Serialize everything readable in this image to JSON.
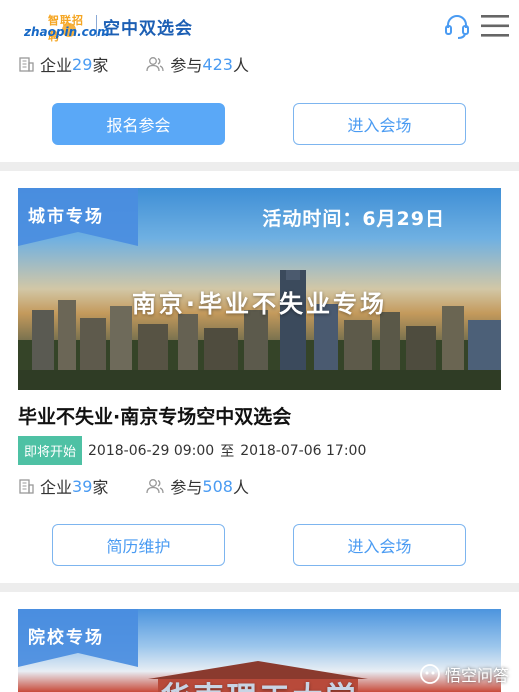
{
  "header": {
    "logo_cn": "智联招聘",
    "logo_en": "zhaopin.com",
    "title": "空中双选会",
    "service_icon": "headset-icon",
    "menu_icon": "menu-icon"
  },
  "card_top": {
    "companies_label": "企业",
    "companies_count": "29",
    "companies_unit": "家",
    "participants_label": "参与",
    "participants_count": "423",
    "participants_unit": "人",
    "primary_button": "报名参会",
    "secondary_button": "进入会场"
  },
  "card_main": {
    "tag": "城市专场",
    "event_time": "活动时间：6月29日",
    "banner_text": "南京·毕业不失业专场",
    "title": "毕业不失业·南京专场空中双选会",
    "status": "即将开始",
    "start": "2018-06-29 09:00",
    "range_sep": "至",
    "end": "2018-07-06 17:00",
    "companies_label": "企业",
    "companies_count": "39",
    "companies_unit": "家",
    "participants_label": "参与",
    "participants_count": "508",
    "participants_unit": "人",
    "primary_button": "简历维护",
    "secondary_button": "进入会场"
  },
  "card_bottom": {
    "tag": "院校专场",
    "banner_text": "华南理工大学"
  },
  "watermark": "悟空问答",
  "colors": {
    "accent": "#4a9bf2",
    "button_fill": "#5aa8f7",
    "status_green": "#4ec1a4",
    "brand_blue": "#1c5fb4",
    "brand_orange": "#f5a623"
  }
}
